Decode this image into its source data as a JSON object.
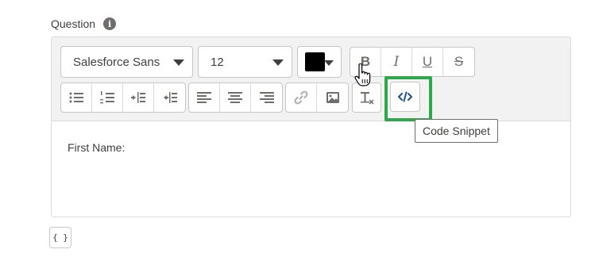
{
  "field": {
    "label": "Question",
    "info_icon": "info-icon"
  },
  "toolbar": {
    "font_family": "Salesforce Sans",
    "font_size": "12",
    "text_color": "#000000",
    "format_buttons": [
      {
        "name": "bold",
        "glyph": "B"
      },
      {
        "name": "italic",
        "glyph": "I"
      },
      {
        "name": "underline",
        "glyph": "U"
      },
      {
        "name": "strikethrough",
        "glyph": "S"
      }
    ],
    "icons": {
      "bulleted_list": "bulleted-list-icon",
      "numbered_list": "numbered-list-icon",
      "indent": "indent-icon",
      "outdent": "outdent-icon",
      "align_left": "align-left-icon",
      "align_center": "align-center-icon",
      "align_right": "align-right-icon",
      "link": "link-icon",
      "image": "image-icon",
      "clear_format": "clear-formatting-icon",
      "code": "code-snippet-icon"
    },
    "highlight_color": "#2ea84a"
  },
  "tooltip": "Code Snippet",
  "editor": {
    "content": "First Name:"
  },
  "merge_field_button": "{ }"
}
